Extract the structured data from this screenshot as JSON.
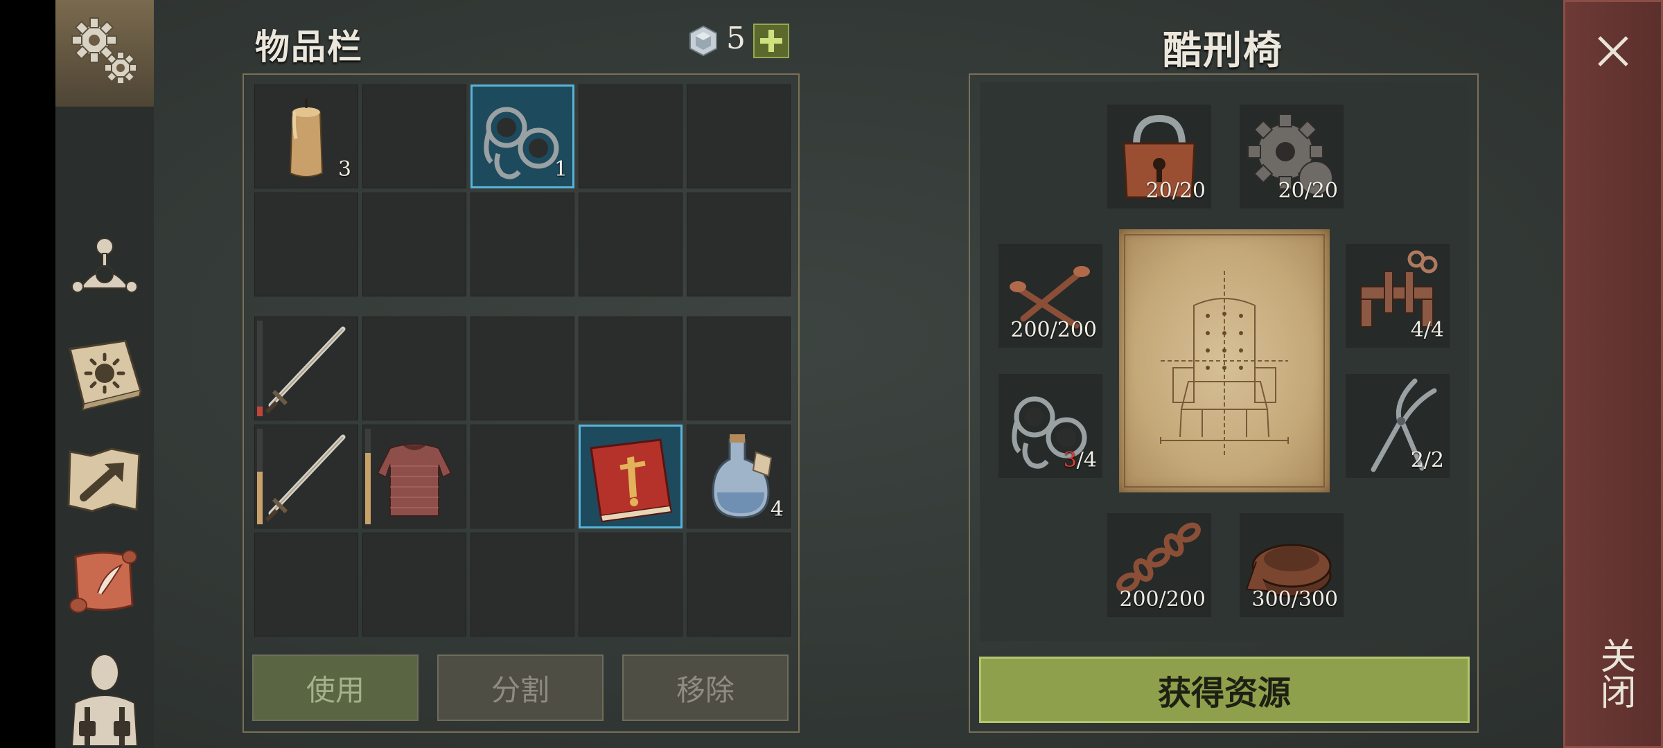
{
  "sidebar": {
    "items": [
      {
        "icon": "gears-icon"
      },
      {
        "icon": "character-skills-icon"
      },
      {
        "icon": "sun-book-icon"
      },
      {
        "icon": "map-icon"
      },
      {
        "icon": "scroll-quest-icon"
      },
      {
        "icon": "character-equipment-icon"
      }
    ]
  },
  "inventory": {
    "title": "物品栏",
    "gem_count": "5",
    "add_icon": "plus-icon",
    "top_grid": [
      {
        "item": "candle",
        "count": "3"
      },
      {
        "item": "",
        "count": ""
      },
      {
        "item": "shackles",
        "count": "1",
        "selected": true
      },
      {
        "item": "",
        "count": ""
      },
      {
        "item": "",
        "count": ""
      },
      {
        "item": "",
        "count": ""
      },
      {
        "item": "",
        "count": ""
      },
      {
        "item": "",
        "count": ""
      },
      {
        "item": "",
        "count": ""
      },
      {
        "item": "",
        "count": ""
      }
    ],
    "bottom_grid": [
      {
        "item": "sword",
        "count": "",
        "durability": 0.1,
        "durability_color": "#c2453a"
      },
      {
        "item": "",
        "count": ""
      },
      {
        "item": "",
        "count": ""
      },
      {
        "item": "",
        "count": ""
      },
      {
        "item": "",
        "count": ""
      },
      {
        "item": "sword",
        "count": "",
        "durability": 0.55,
        "durability_color": "#c9a26a"
      },
      {
        "item": "chainmail",
        "count": "",
        "durability": 0.75,
        "durability_color": "#c9a26a"
      },
      {
        "item": "",
        "count": ""
      },
      {
        "item": "red-book",
        "count": "",
        "selected": true
      },
      {
        "item": "potion",
        "count": "4"
      },
      {
        "item": "",
        "count": ""
      },
      {
        "item": "",
        "count": ""
      },
      {
        "item": "",
        "count": ""
      },
      {
        "item": "",
        "count": ""
      },
      {
        "item": "",
        "count": ""
      }
    ],
    "buttons": {
      "use": "使用",
      "split": "分割",
      "remove": "移除"
    }
  },
  "recipe": {
    "title": "酷刑椅",
    "resources": [
      {
        "item": "padlock",
        "have": "20",
        "need": "20"
      },
      {
        "item": "gear",
        "have": "20",
        "need": "20"
      },
      {
        "item": "nails",
        "have": "200",
        "need": "200"
      },
      {
        "item": "clamp",
        "have": "4",
        "need": "4"
      },
      {
        "item": "shackles",
        "have": "3",
        "need": "4",
        "insufficient": true
      },
      {
        "item": "pliers",
        "have": "2",
        "need": "2"
      },
      {
        "item": "chain",
        "have": "200",
        "need": "200"
      },
      {
        "item": "leather",
        "have": "300",
        "need": "300"
      }
    ],
    "blueprint": "torture-chair-blueprint",
    "get_resources": "获得资源"
  },
  "close": {
    "label": "关闭",
    "icon": "close-icon"
  },
  "colors": {
    "accent_green": "#8ea04b",
    "insufficient": "#e03a2e",
    "selected": "#58b4d8",
    "close_strip": "#6e3a36"
  }
}
